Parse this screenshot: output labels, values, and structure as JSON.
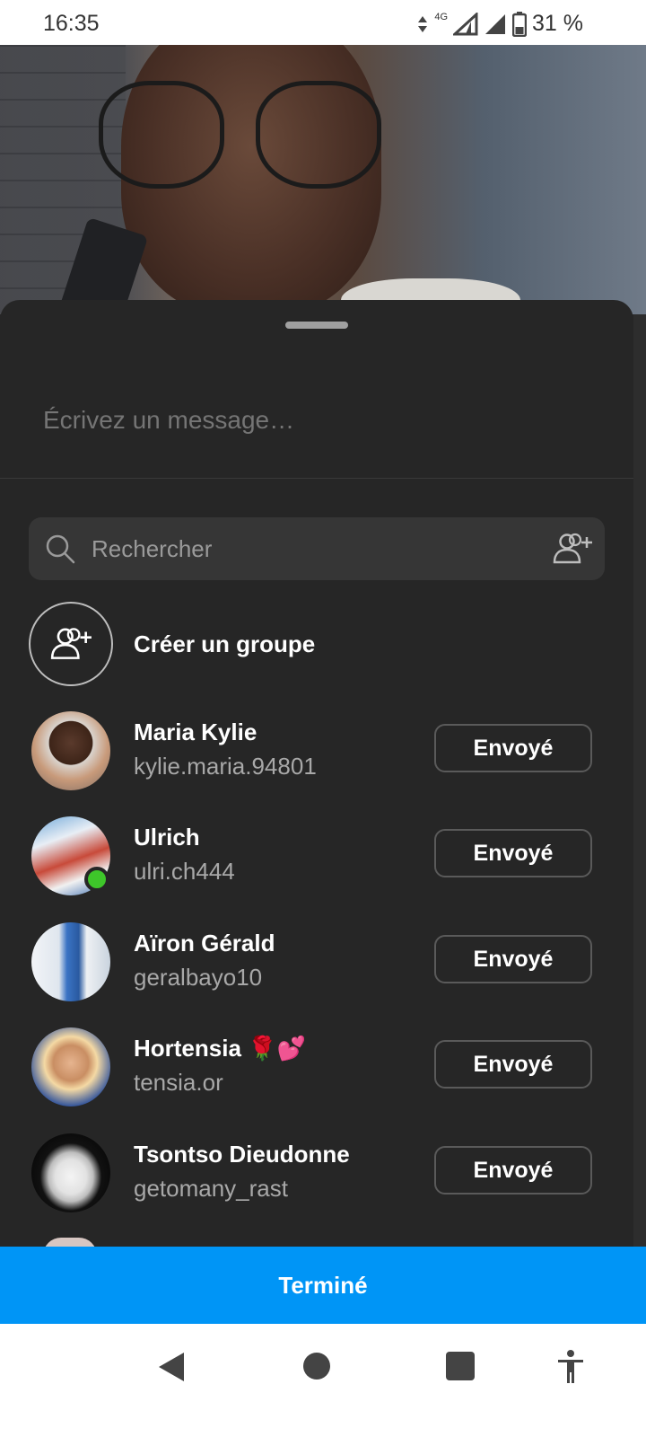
{
  "status_bar": {
    "time": "16:35",
    "network": "4G",
    "battery": "31 %"
  },
  "sheet": {
    "message_placeholder": "Écrivez un message…",
    "search_placeholder": "Rechercher",
    "create_group_label": "Créer un groupe",
    "contacts": [
      {
        "name": "Maria Kylie",
        "username": "kylie.maria.94801",
        "button": "Envoyé",
        "online": false
      },
      {
        "name": "Ulrich",
        "username": "ulri.ch444",
        "button": "Envoyé",
        "online": true
      },
      {
        "name": "Aïron Gérald",
        "username": "geralbayo10",
        "button": "Envoyé",
        "online": false
      },
      {
        "name": "Hortensia 🌹💕",
        "username": "tensia.or",
        "button": "Envoyé",
        "online": false
      },
      {
        "name": "Tsontso Dieudonne",
        "username": "getomany_rast",
        "button": "Envoyé",
        "online": false
      }
    ],
    "done_label": "Terminé"
  },
  "colors": {
    "sheet_bg": "#262626",
    "accent": "#0095f6",
    "online": "#3ec62a"
  },
  "icons": [
    "search-icon",
    "add-people-icon",
    "back-icon",
    "home-icon",
    "recents-icon",
    "accessibility-icon"
  ]
}
